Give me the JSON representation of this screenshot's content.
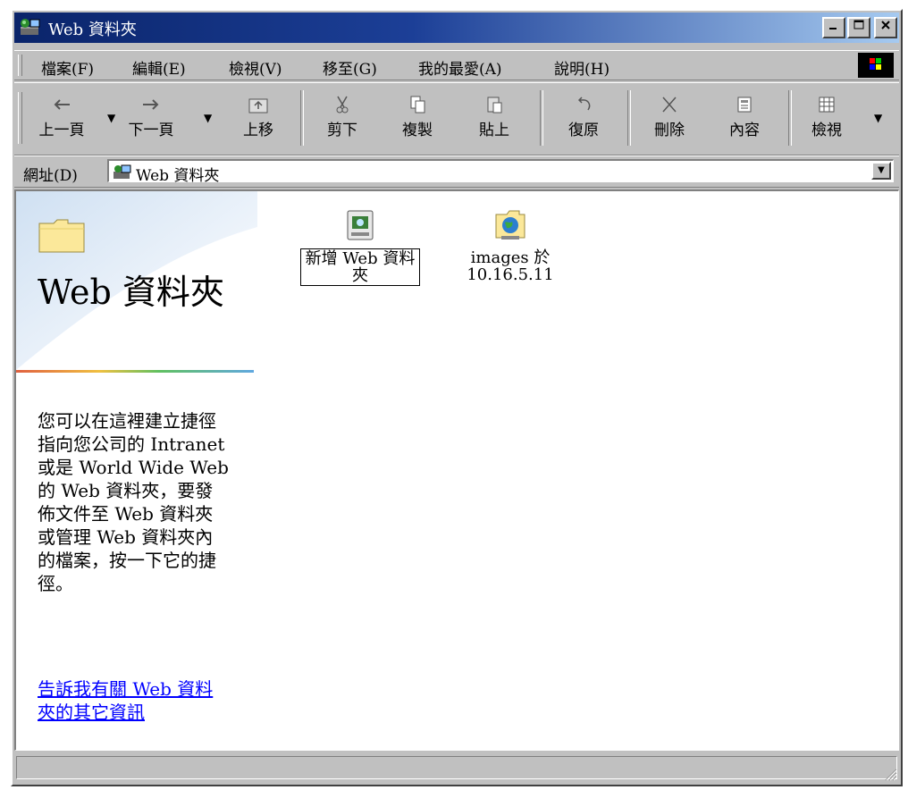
{
  "window": {
    "title": "Web 資料夾",
    "icon": "web-folder-icon"
  },
  "menu": {
    "items": [
      "檔案(F)",
      "編輯(E)",
      "檢視(V)",
      "移至(G)",
      "我的最愛(A)",
      "說明(H)"
    ]
  },
  "toolbar": {
    "back_label": "上一頁",
    "forward_label": "下一頁",
    "up_label": "上移",
    "cut_label": "剪下",
    "copy_label": "複製",
    "paste_label": "貼上",
    "undo_label": "復原",
    "delete_label": "刪除",
    "properties_label": "內容",
    "views_label": "檢視"
  },
  "address": {
    "label": "網址(D)",
    "value": "Web 資料夾"
  },
  "left_pane": {
    "title": "Web 資料夾",
    "description": "您可以在這裡建立捷徑指向您公司的 Intranet 或是 World Wide Web 的 Web 資料夾，要發佈文件至 Web 資料夾或管理 Web 資料夾內的檔案，按一下它的捷徑。",
    "link": "告訴我有關 Web 資料夾的其它資訊"
  },
  "items": [
    {
      "label": "新增 Web 資料夾",
      "icon": "add-web-folder-icon",
      "selected": true
    },
    {
      "label": "images 於 10.16.5.11",
      "icon": "web-folder-globe-icon",
      "selected": false
    }
  ],
  "status": {
    "text": ""
  }
}
